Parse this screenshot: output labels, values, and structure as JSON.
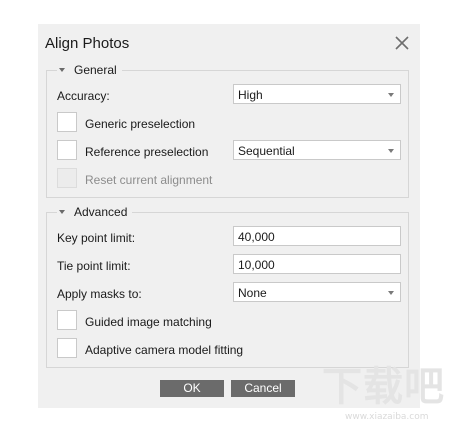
{
  "dialog": {
    "title": "Align Photos",
    "close_icon": "close-icon"
  },
  "general": {
    "legend": "General",
    "accuracy_label": "Accuracy:",
    "accuracy_value": "High",
    "generic_preselection_label": "Generic preselection",
    "reference_preselection_label": "Reference preselection",
    "reference_preselection_value": "Sequential",
    "reset_alignment_label": "Reset current alignment"
  },
  "advanced": {
    "legend": "Advanced",
    "key_point_label": "Key point limit:",
    "key_point_value": "40,000",
    "tie_point_label": "Tie point limit:",
    "tie_point_value": "10,000",
    "apply_masks_label": "Apply masks to:",
    "apply_masks_value": "None",
    "guided_matching_label": "Guided image matching",
    "adaptive_fitting_label": "Adaptive camera model fitting"
  },
  "buttons": {
    "ok": "OK",
    "cancel": "Cancel"
  },
  "watermark": {
    "text": "下载吧",
    "url": "www.xiazaiba.com"
  }
}
